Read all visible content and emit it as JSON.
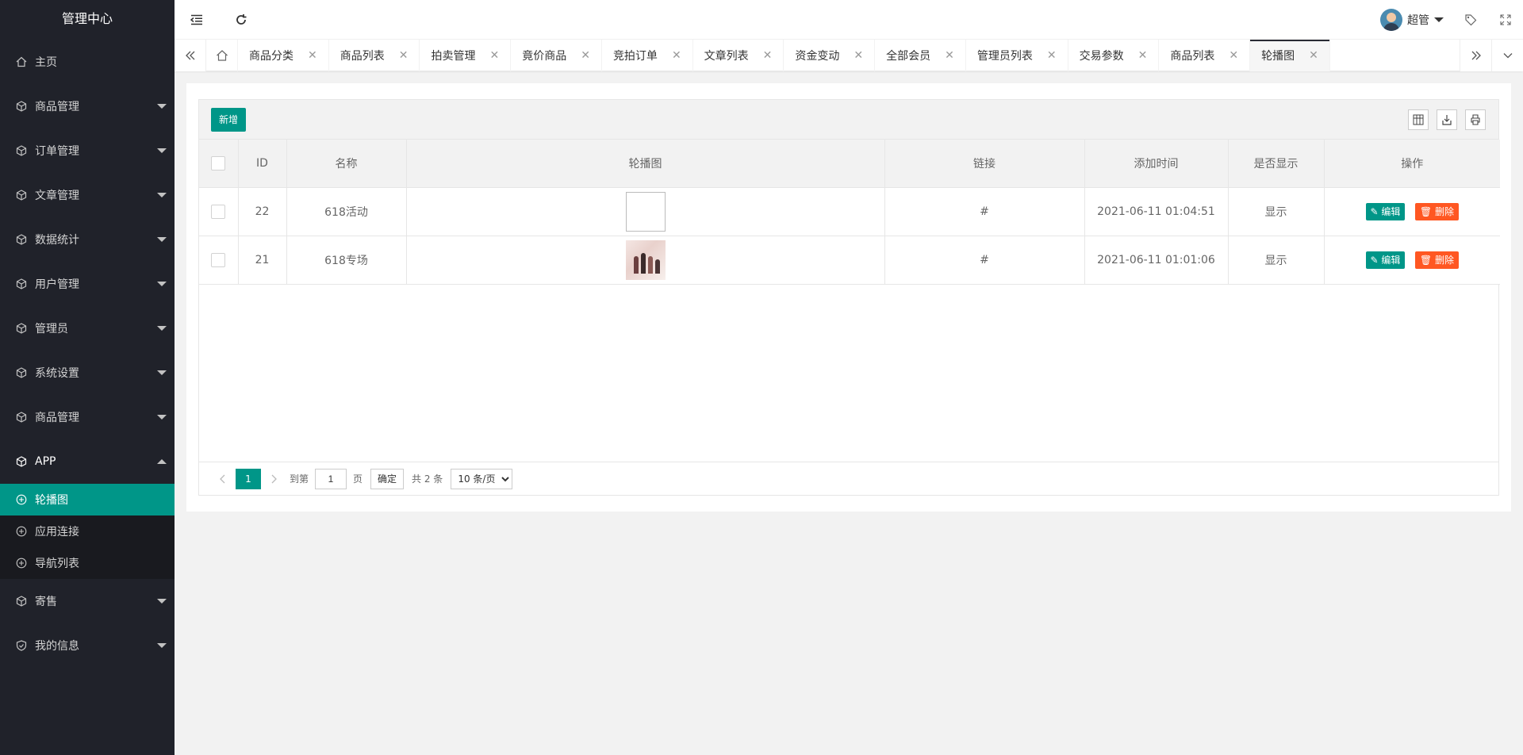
{
  "app_title": "管理中心",
  "sidebar": {
    "home": "主页",
    "groups": [
      {
        "label": "商品管理"
      },
      {
        "label": "订单管理"
      },
      {
        "label": "文章管理"
      },
      {
        "label": "数据统计"
      },
      {
        "label": "用户管理"
      },
      {
        "label": "管理员"
      },
      {
        "label": "系统设置"
      },
      {
        "label": "商品管理"
      }
    ],
    "app_group": "APP",
    "app_items": [
      "轮播图",
      "应用连接",
      "导航列表"
    ],
    "after_groups": [
      {
        "label": "寄售"
      },
      {
        "label": "我的信息"
      }
    ]
  },
  "header": {
    "user_name": "超管"
  },
  "tabs": [
    "商品分类",
    "商品列表",
    "拍卖管理",
    "竟价商品",
    "竞拍订单",
    "文章列表",
    "资金变动",
    "全部会员",
    "管理员列表",
    "交易参数",
    "商品列表",
    "轮播图"
  ],
  "toolbar": {
    "add_label": "新增"
  },
  "table": {
    "headers": {
      "id": "ID",
      "name": "名称",
      "image": "轮播图",
      "link": "链接",
      "time": "添加时间",
      "show": "是否显示",
      "op": "操作"
    },
    "rows": [
      {
        "id": "22",
        "name": "618活动",
        "link": "#",
        "time": "2021-06-11 01:04:51",
        "show": "显示"
      },
      {
        "id": "21",
        "name": "618专场",
        "link": "#",
        "time": "2021-06-11 01:01:06",
        "show": "显示"
      }
    ],
    "edit_label": "编辑",
    "delete_label": "删除"
  },
  "pager": {
    "current": "1",
    "goto_label": "到第",
    "goto_value": "1",
    "page_unit": "页",
    "confirm": "确定",
    "total": "共 2 条",
    "page_size": "10 条/页"
  }
}
